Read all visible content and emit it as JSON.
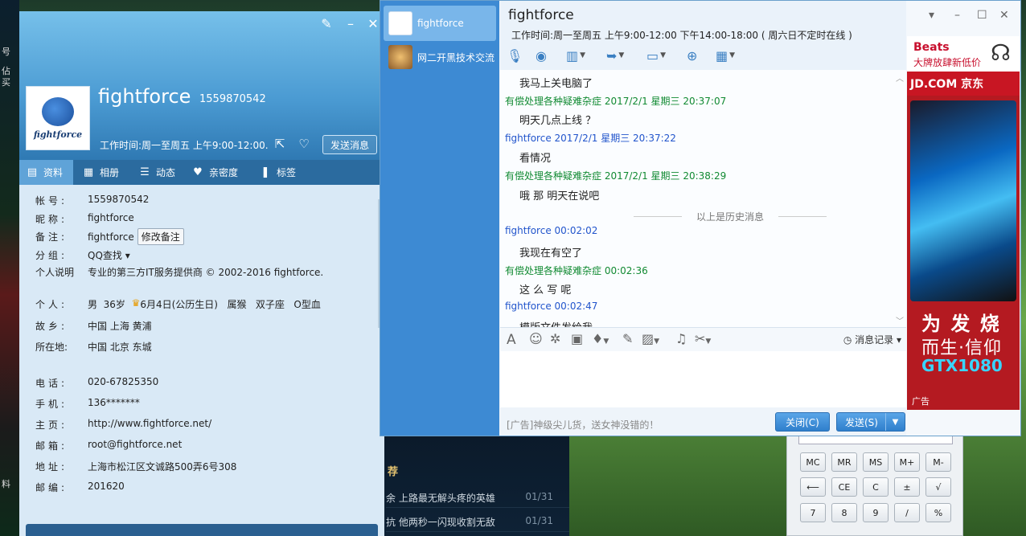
{
  "desktop": {
    "left_texts": [
      "号",
      "佔",
      "买"
    ],
    "left_bottom": "料",
    "mid_heading": "荐",
    "mid_rows": [
      {
        "text": "余 上路最无解头疼的英雄",
        "date": "01/31"
      },
      {
        "text": "抗 他两秒一闪现收割无敌",
        "date": "01/31"
      }
    ]
  },
  "calculator": {
    "rows": [
      [
        "MC",
        "MR",
        "MS",
        "M+",
        "M-"
      ],
      [
        "⟵",
        "CE",
        "C",
        "±",
        "√"
      ],
      [
        "7",
        "8",
        "9",
        "/",
        "%"
      ]
    ]
  },
  "profile": {
    "name": "fightforce",
    "qq": "1559870542",
    "avatar_word": "fightforce",
    "hours": "工作时间:周一至周五 上午9:00-12:00...",
    "send_button": "发送消息",
    "tabs": [
      {
        "icon": "id-card-icon",
        "label": "资料"
      },
      {
        "icon": "photo-icon",
        "label": "相册"
      },
      {
        "icon": "list-icon",
        "label": "动态"
      },
      {
        "icon": "heart-icon",
        "label": "亲密度"
      },
      {
        "icon": "bookmark-icon",
        "label": "标签"
      }
    ],
    "fields": {
      "account": {
        "k": "帐号:",
        "v": "1559870542"
      },
      "nick": {
        "k": "昵称:",
        "v": "fightforce"
      },
      "remark": {
        "k": "备注:",
        "v": "fightforce",
        "btn": "修改备注"
      },
      "group": {
        "k": "分组:",
        "v": "QQ查找"
      },
      "desc": {
        "k": "个人说明",
        "v": "专业的第三方IT服务提供商 © 2002-2016 fightforce."
      },
      "personal": {
        "k": "个人:",
        "gender": "男",
        "age": "36岁",
        "birthday": "6月4日(公历生日)",
        "zodiac": "属猴",
        "star": "双子座",
        "blood": "O型血"
      },
      "hometown": {
        "k": "故乡:",
        "v": "中国 上海 黄浦"
      },
      "location": {
        "k": "所在地:",
        "v": "中国 北京 东城"
      },
      "phone": {
        "k": "电话:",
        "v": "020-67825350"
      },
      "mobile": {
        "k": "手机:",
        "v": "136*******"
      },
      "homepage": {
        "k": "主页:",
        "v": "http://www.fightforce.net/"
      },
      "email": {
        "k": "邮箱:",
        "v": "root@fightforce.net"
      },
      "address": {
        "k": "地址:",
        "v": "上海市松江区文诚路500弄6号308"
      },
      "zip": {
        "k": "邮编:",
        "v": "201620"
      }
    }
  },
  "chat": {
    "contacts": [
      {
        "name": "fightforce",
        "active": true
      },
      {
        "name": "网二开黑技术交流",
        "active": false
      }
    ],
    "title": "fightforce",
    "hours": "工作时间:周一至周五  上午9:00-12:00  下午14:00-18:00 ( 周六日不定时在线 )",
    "messages": [
      {
        "type": "t",
        "text": "我马上关电脑了"
      },
      {
        "type": "g",
        "text": "有偿处理各种疑难杂症 2017/2/1 星期三 20:37:07"
      },
      {
        "type": "t",
        "text": "明天几点上线 ？"
      },
      {
        "type": "b",
        "text": "fightforce 2017/2/1 星期三 20:37:22"
      },
      {
        "type": "t",
        "text": "看情况"
      },
      {
        "type": "g",
        "text": "有偿处理各种疑难杂症 2017/2/1 星期三 20:38:29"
      },
      {
        "type": "t",
        "text": "哦 那 明天在说吧"
      },
      {
        "type": "b",
        "text": "fightforce   00:02:02"
      },
      {
        "type": "t",
        "text": "我现在有空了"
      },
      {
        "type": "g",
        "text": "有偿处理各种疑难杂症   00:02:36"
      },
      {
        "type": "t",
        "text": "这 么 写 呢"
      },
      {
        "type": "b",
        "text": "fightforce   00:02:47"
      },
      {
        "type": "t",
        "text": "模版文件发给我"
      }
    ],
    "history_divider": "以上是历史消息",
    "history_link": "消息记录",
    "footer_ad": "[广告]神级尖儿货，送女神没错的！",
    "close_button": "关闭(C)",
    "send_button": "发送(S)",
    "ad": {
      "beats": "Beats",
      "beats_sub": "大牌放肆新低价",
      "jd": "JD.COM 京东",
      "line1": "为 发 烧",
      "line2": "而生·信仰",
      "line3": "GTX1080",
      "label": "广告"
    }
  }
}
